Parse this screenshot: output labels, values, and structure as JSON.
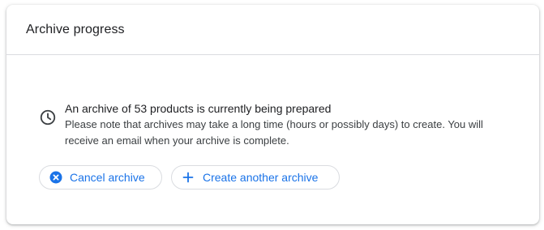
{
  "card": {
    "title": "Archive progress"
  },
  "notice": {
    "icon": "clock-icon",
    "headline": "An archive of 53 products is currently being prepared",
    "body_line1": "Please note that archives may take a long time (hours or possibly days) to create. You will",
    "body_line2": "receive an email when your archive is complete."
  },
  "actions": {
    "cancel_label": "Cancel archive",
    "cancel_icon": "cancel-circle-icon",
    "create_label": "Create another archive",
    "create_icon": "plus-icon"
  },
  "colors": {
    "accent": "#1a73e8",
    "text_primary": "#202124",
    "text_secondary": "#3c4043",
    "border": "#dadce0"
  }
}
